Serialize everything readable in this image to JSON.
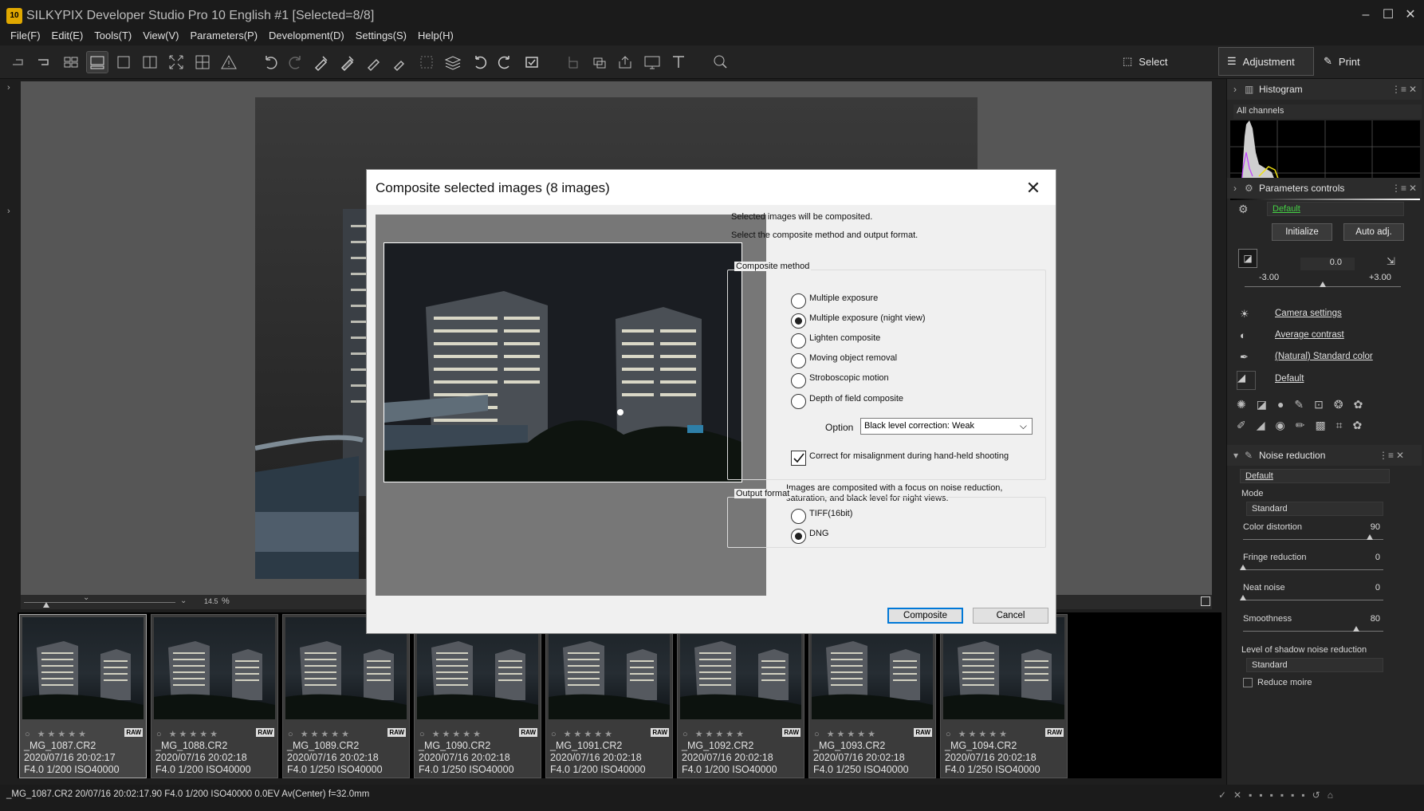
{
  "app": {
    "title": "SILKYPIX Developer Studio Pro 10 English   #1   [Selected=8/8]",
    "icon_text": "10"
  },
  "window_controls": {
    "minimize": "–",
    "maximize": "☐",
    "close": "✕"
  },
  "menu": [
    "File(F)",
    "Edit(E)",
    "Tools(T)",
    "View(V)",
    "Parameters(P)",
    "Development(D)",
    "Settings(S)",
    "Help(H)"
  ],
  "modes": {
    "select": "Select",
    "adjustment": "Adjustment",
    "print": "Print"
  },
  "zoom": {
    "value": "14.5",
    "unit": "%"
  },
  "filmstrip": [
    {
      "name": "_MG_1087.CR2",
      "date": "2020/07/16 20:02:17",
      "exif": "F4.0 1/200 ISO40000"
    },
    {
      "name": "_MG_1088.CR2",
      "date": "2020/07/16 20:02:18",
      "exif": "F4.0 1/200 ISO40000"
    },
    {
      "name": "_MG_1089.CR2",
      "date": "2020/07/16 20:02:18",
      "exif": "F4.0 1/250 ISO40000"
    },
    {
      "name": "_MG_1090.CR2",
      "date": "2020/07/16 20:02:18",
      "exif": "F4.0 1/250 ISO40000"
    },
    {
      "name": "_MG_1091.CR2",
      "date": "2020/07/16 20:02:18",
      "exif": "F4.0 1/200 ISO40000"
    },
    {
      "name": "_MG_1092.CR2",
      "date": "2020/07/16 20:02:18",
      "exif": "F4.0 1/200 ISO40000"
    },
    {
      "name": "_MG_1093.CR2",
      "date": "2020/07/16 20:02:18",
      "exif": "F4.0 1/250 ISO40000"
    },
    {
      "name": "_MG_1094.CR2",
      "date": "2020/07/16 20:02:18",
      "exif": "F4.0 1/250 ISO40000"
    }
  ],
  "thumb_badge": "RAW",
  "stars": "○ ★★★★★",
  "statusbar": {
    "text": "_MG_1087.CR2 20/07/16 20:02:17.90 F4.0 1/200 ISO40000  0.0EV Av(Center) f=32.0mm"
  },
  "panel": {
    "histogram": {
      "title": "Histogram",
      "channel": "All channels"
    },
    "params": {
      "title": "Parameters controls",
      "preset": "Default",
      "initialize": "Initialize",
      "auto_adj": "Auto adj.",
      "exposure_value": "0.0",
      "exposure_min": "-3.00",
      "exposure_max": "+3.00",
      "camera_settings": "Camera settings",
      "contrast": "Average contrast",
      "color": "(Natural) Standard color",
      "sharpness": "Default"
    },
    "noise": {
      "title": "Noise reduction",
      "preset": "Default",
      "mode_label": "Mode",
      "mode_value": "Standard",
      "color_distortion_label": "Color distortion",
      "color_distortion_value": "90",
      "fringe_label": "Fringe reduction",
      "fringe_value": "0",
      "neat_label": "Neat noise",
      "neat_value": "0",
      "smooth_label": "Smoothness",
      "smooth_value": "80",
      "shadow_label": "Level of shadow noise reduction",
      "shadow_value": "Standard",
      "moire_label": "Reduce moire"
    }
  },
  "dialog": {
    "title": "Composite selected images (8 images)",
    "intro1": "Selected images will be composited.",
    "intro2": "Select the composite method and output format.",
    "method_group": "Composite method",
    "methods": [
      {
        "label": "Multiple exposure",
        "selected": false
      },
      {
        "label": "Multiple exposure (night view)",
        "selected": true
      },
      {
        "label": "Lighten composite",
        "selected": false
      },
      {
        "label": "Moving object removal",
        "selected": false
      },
      {
        "label": "Stroboscopic motion",
        "selected": false
      },
      {
        "label": "Depth of field composite",
        "selected": false
      }
    ],
    "option_label": "Option",
    "option_value": "Black level correction: Weak",
    "misalign_label": "Correct for misalignment during hand-held shooting",
    "misalign_checked": true,
    "description": "Images are composited with a focus on noise reduction,\nsaturation, and black level for night views.",
    "output_group": "Output format",
    "outputs": [
      {
        "label": "TIFF(16bit)",
        "selected": false
      },
      {
        "label": "DNG",
        "selected": true
      }
    ],
    "composite_btn": "Composite",
    "cancel_btn": "Cancel"
  }
}
